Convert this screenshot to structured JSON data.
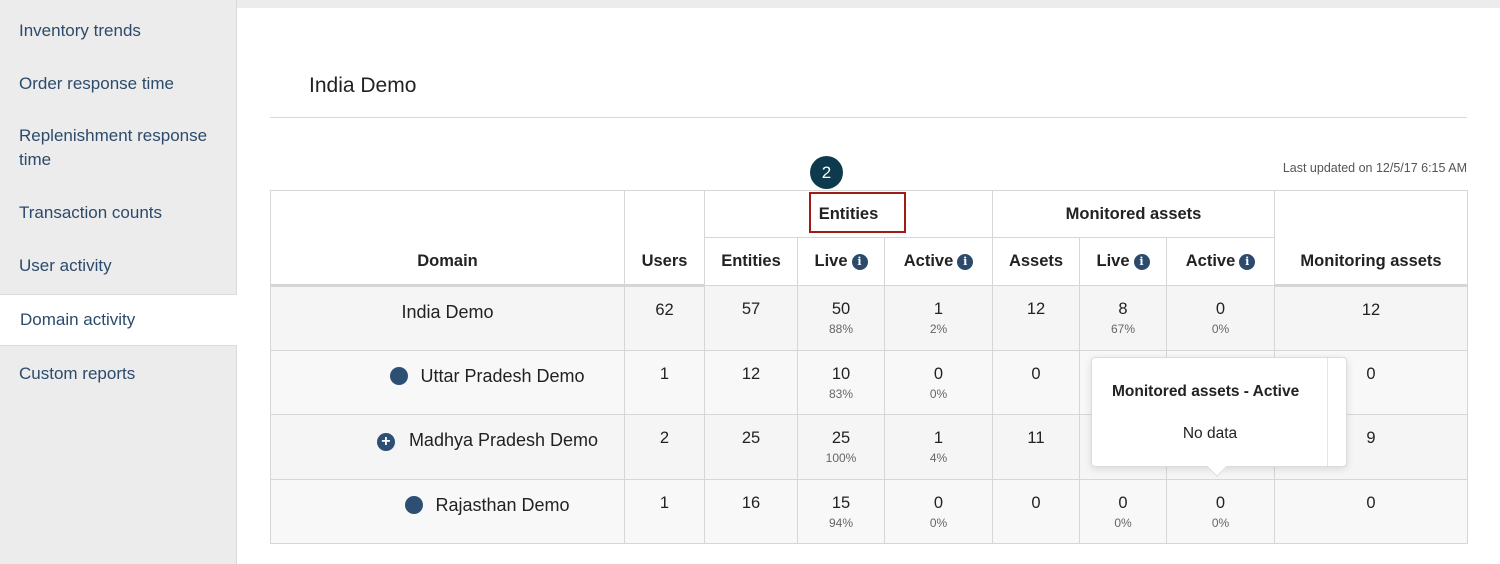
{
  "sidebar": {
    "items": [
      {
        "label": "Inventory trends"
      },
      {
        "label": "Order response time"
      },
      {
        "label": "Replenishment response time"
      },
      {
        "label": "Transaction counts"
      },
      {
        "label": "User activity"
      },
      {
        "label": "Domain activity",
        "active": true
      },
      {
        "label": "Custom reports"
      }
    ]
  },
  "main": {
    "title": "India Demo",
    "last_updated": "Last updated on 12/5/17 6:15 AM",
    "step_badge": "2"
  },
  "table": {
    "group_headers": {
      "entities": "Entities",
      "monitored_assets": "Monitored assets"
    },
    "columns": {
      "domain": "Domain",
      "users": "Users",
      "entities": "Entities",
      "live": "Live",
      "active": "Active",
      "assets": "Assets",
      "assets_live": "Live",
      "assets_active": "Active",
      "monitoring_assets": "Monitoring assets"
    },
    "rows": [
      {
        "domain": "India Demo",
        "users": "62",
        "entities": "57",
        "live": "50",
        "live_pct": "88%",
        "active": "1",
        "active_pct": "2%",
        "assets": "12",
        "assets_live": "8",
        "assets_live_pct": "67%",
        "assets_active": "0",
        "assets_active_pct": "0%",
        "monitoring": "12"
      },
      {
        "domain": "Uttar Pradesh Demo",
        "users": "1",
        "entities": "12",
        "live": "10",
        "live_pct": "83%",
        "active": "0",
        "active_pct": "0%",
        "assets": "0",
        "monitoring": "0"
      },
      {
        "domain": "Madhya Pradesh Demo",
        "users": "2",
        "entities": "25",
        "live": "25",
        "live_pct": "100%",
        "active": "1",
        "active_pct": "4%",
        "assets": "11",
        "monitoring": "9"
      },
      {
        "domain": "Rajasthan Demo",
        "users": "1",
        "entities": "16",
        "live": "15",
        "live_pct": "94%",
        "active": "0",
        "active_pct": "0%",
        "assets": "0",
        "assets_live": "0",
        "assets_live_pct": "0%",
        "assets_active": "0",
        "assets_active_pct": "0%",
        "monitoring": "0"
      }
    ]
  },
  "tooltip": {
    "title": "Monitored assets - Active",
    "body": "No data"
  },
  "colors": {
    "accent": "#2c4a6b",
    "badge": "#0d3a4c",
    "highlight": "#a11a1a"
  }
}
